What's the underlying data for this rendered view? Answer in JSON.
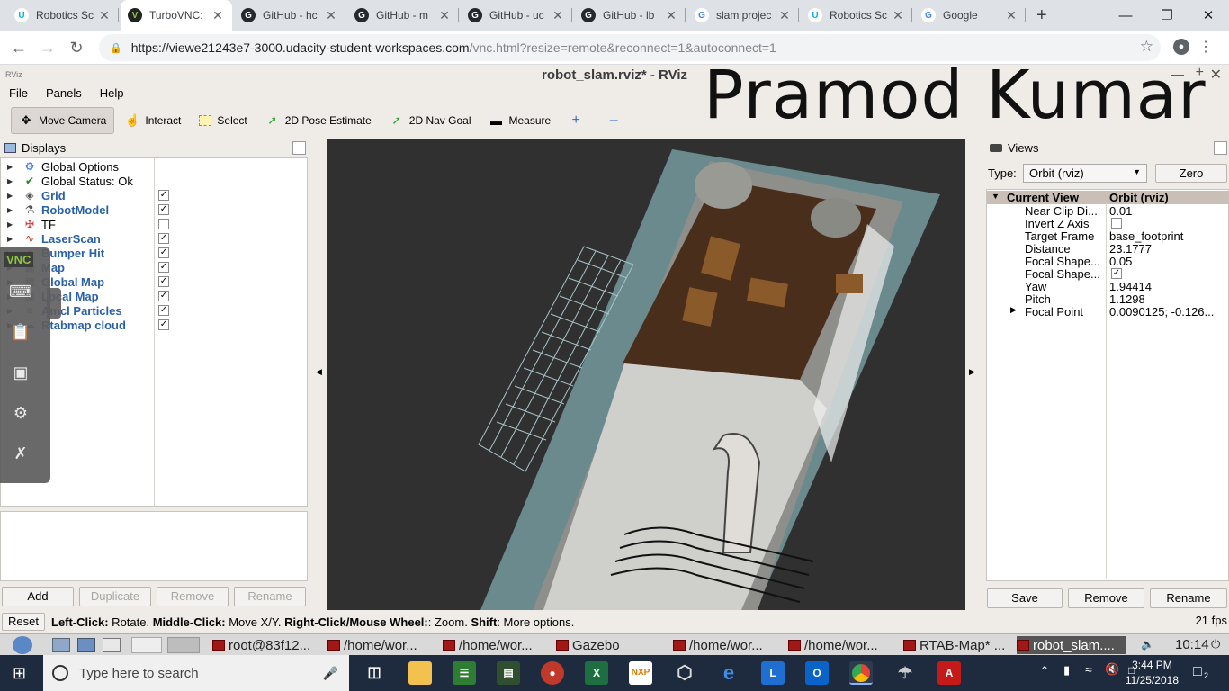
{
  "browser": {
    "tabs": [
      {
        "label": "Robotics Sc",
        "icon": "udacity-icon",
        "active": false
      },
      {
        "label": "TurboVNC:",
        "icon": "vnc-icon",
        "active": true
      },
      {
        "label": "GitHub - hc",
        "icon": "github-icon",
        "active": false
      },
      {
        "label": "GitHub - m",
        "icon": "github-icon",
        "active": false
      },
      {
        "label": "GitHub - uc",
        "icon": "github-icon",
        "active": false
      },
      {
        "label": "GitHub - lb",
        "icon": "github-icon",
        "active": false
      },
      {
        "label": "slam projec",
        "icon": "google-icon",
        "active": false
      },
      {
        "label": "Robotics Sc",
        "icon": "udacity-icon",
        "active": false
      },
      {
        "label": "Google",
        "icon": "google-icon",
        "active": false
      }
    ],
    "url_host": "https://viewe21243e7-3000.udacity-student-workspaces.com",
    "url_path": "/vnc.html?resize=remote&reconnect=1&autoconnect=1"
  },
  "rviz": {
    "window_title": "robot_slam.rviz* - RViz",
    "watermark": "Pramod Kumar",
    "menu": [
      "File",
      "Panels",
      "Help"
    ],
    "tools": [
      {
        "label": "Move Camera",
        "icon": "move-camera-icon",
        "pressed": true
      },
      {
        "label": "Interact",
        "icon": "interact-icon",
        "pressed": false
      },
      {
        "label": "Select",
        "icon": "select-icon",
        "pressed": false
      },
      {
        "label": "2D Pose Estimate",
        "icon": "pose-estimate-icon",
        "pressed": false
      },
      {
        "label": "2D Nav Goal",
        "icon": "nav-goal-icon",
        "pressed": false
      },
      {
        "label": "Measure",
        "icon": "measure-icon",
        "pressed": false
      }
    ],
    "displays": {
      "title": "Displays",
      "items": [
        {
          "label": "Global Options",
          "blue": false,
          "checkbox": null,
          "icon": "gear-icon"
        },
        {
          "label": "Global Status: Ok",
          "blue": false,
          "checkbox": null,
          "icon": "check-icon"
        },
        {
          "label": "Grid",
          "blue": true,
          "checkbox": true,
          "icon": "grid-icon"
        },
        {
          "label": "RobotModel",
          "blue": true,
          "checkbox": true,
          "icon": "robot-icon"
        },
        {
          "label": "TF",
          "blue": false,
          "checkbox": false,
          "icon": "tf-icon"
        },
        {
          "label": "LaserScan",
          "blue": true,
          "checkbox": true,
          "icon": "laser-icon"
        },
        {
          "label": "Bumper Hit",
          "blue": true,
          "checkbox": true,
          "icon": "bumper-icon"
        },
        {
          "label": "Map",
          "blue": true,
          "checkbox": true,
          "icon": "map-icon"
        },
        {
          "label": "Global Map",
          "blue": true,
          "checkbox": true,
          "icon": "map-icon"
        },
        {
          "label": "Local Map",
          "blue": true,
          "checkbox": true,
          "icon": "map-icon"
        },
        {
          "label": "Amcl Particles",
          "blue": true,
          "checkbox": true,
          "icon": "particles-icon"
        },
        {
          "label": "Rtabmap cloud",
          "blue": true,
          "checkbox": true,
          "icon": "cloud-icon"
        }
      ],
      "buttons": {
        "add": "Add",
        "duplicate": "Duplicate",
        "remove": "Remove",
        "rename": "Rename"
      }
    },
    "views": {
      "title": "Views",
      "type_label": "Type:",
      "type_value": "Orbit (rviz)",
      "zero": "Zero",
      "header_key": "Current View",
      "header_val": "Orbit (rviz)",
      "rows": [
        {
          "k": "Near Clip Di...",
          "v": "0.01",
          "checkbox": null
        },
        {
          "k": "Invert Z Axis",
          "v": "",
          "checkbox": false
        },
        {
          "k": "Target Frame",
          "v": "base_footprint",
          "checkbox": null
        },
        {
          "k": "Distance",
          "v": "23.1777",
          "checkbox": null
        },
        {
          "k": "Focal Shape...",
          "v": "0.05",
          "checkbox": null
        },
        {
          "k": "Focal Shape...",
          "v": "",
          "checkbox": true
        },
        {
          "k": "Yaw",
          "v": "1.94414",
          "checkbox": null
        },
        {
          "k": "Pitch",
          "v": "1.1298",
          "checkbox": null
        },
        {
          "k": "Focal Point",
          "v": "0.0090125; -0.126...",
          "checkbox": null
        }
      ],
      "buttons": {
        "save": "Save",
        "remove": "Remove",
        "rename": "Rename"
      }
    },
    "status": {
      "reset": "Reset",
      "b1": "Left-Click:",
      "t1": " Rotate. ",
      "b2": "Middle-Click:",
      "t2": " Move X/Y. ",
      "b3": "Right-Click/Mouse Wheel:",
      "t3": ": Zoom. ",
      "b4": "Shift",
      "t4": ": More options.",
      "fps": "21 fps"
    }
  },
  "linux_taskbar": {
    "windows": [
      "root@83f12...",
      "/home/wor...",
      "/home/wor...",
      "Gazebo",
      "/home/wor...",
      "/home/wor...",
      "RTAB-Map* ...",
      "robot_slam...."
    ],
    "time": "10:14"
  },
  "windows_taskbar": {
    "search_placeholder": "Type here to search",
    "time": "3:44 PM",
    "date": "11/25/2018",
    "notifications": "2"
  },
  "colors": {
    "rviz_bg": "#efebe7",
    "blue_label": "#2a60a8",
    "floor_wood": "#4a2e1c",
    "grid_line": "#a8c4c8"
  }
}
